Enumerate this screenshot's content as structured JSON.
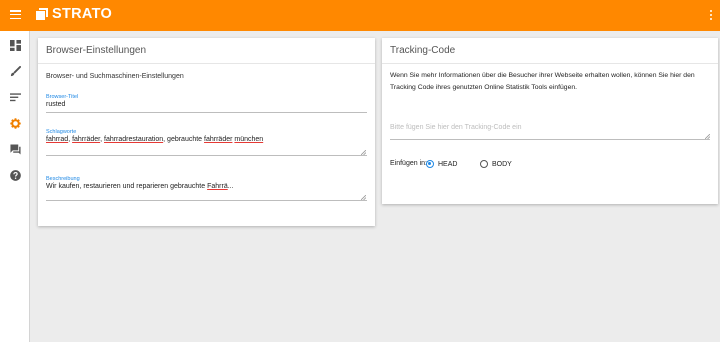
{
  "brand": {
    "logo_text": "STRATO"
  },
  "colors": {
    "topbar": "#ff8800",
    "accent": "#1e88e5"
  },
  "icons": {
    "menu": "hamburger-icon",
    "more": "kebab-menu-icon",
    "sidebar": [
      "dashboard-icon",
      "brush-icon",
      "list-icon",
      "settings-icon",
      "chat-icon",
      "help-icon"
    ]
  },
  "browser_card": {
    "title": "Browser-Einstellungen",
    "subheading": "Browser- und Suchmaschinen-Einstellungen",
    "browser_title": {
      "label": "Browser-Titel",
      "value": "rusted"
    },
    "keywords": {
      "label": "Schlagworte",
      "value": "fahrrad, fahrräder, fahrradrestauration, gebrauchte fahrräder münchen"
    },
    "description": {
      "label": "Beschreibung",
      "value": "Wir kaufen, restaurieren und reparieren gebrauchte Fahrrä..."
    }
  },
  "tracking_card": {
    "title": "Tracking-Code",
    "description": "Wenn Sie mehr Informationen über die Besucher ihrer Webseite erhalten wollen, können Sie hier den Tracking Code ihres genutzten Online Statistik Tools einfügen.",
    "placeholder": "Bitte fügen Sie hier den Tracking-Code ein",
    "insert_label": "Einfügen in:",
    "options": [
      {
        "label": "HEAD",
        "checked": true
      },
      {
        "label": "BODY",
        "checked": false
      }
    ]
  }
}
